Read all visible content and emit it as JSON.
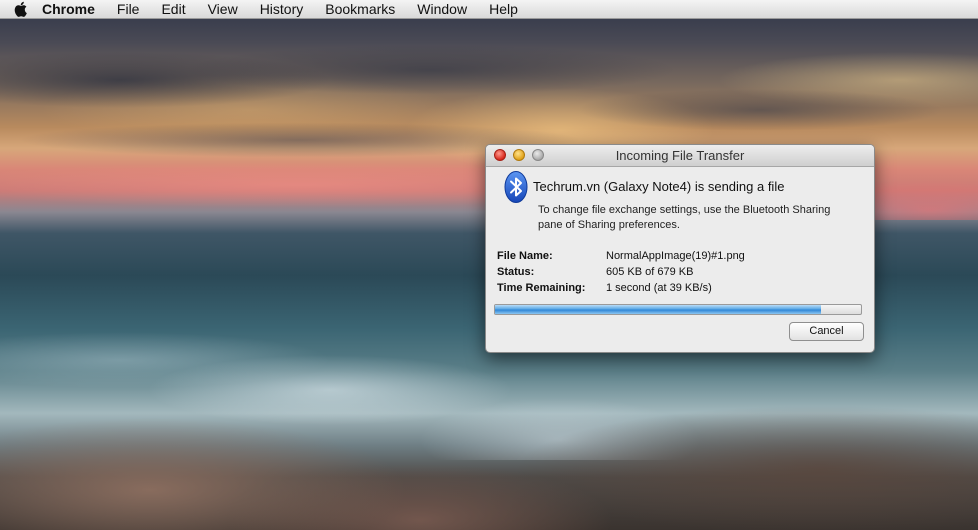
{
  "menubar": {
    "apple_icon": "apple-logo-icon",
    "app_name": "Chrome",
    "items": [
      "File",
      "Edit",
      "View",
      "History",
      "Bookmarks",
      "Window",
      "Help"
    ]
  },
  "dialog": {
    "title": "Incoming File Transfer",
    "icon": "bluetooth-icon",
    "headline": "Techrum.vn (Galaxy Note4) is sending a file",
    "description": "To change file exchange settings, use the Bluetooth Sharing pane of Sharing preferences.",
    "details": [
      {
        "label": "File Name:",
        "value": "NormalAppImage(19)#1.png"
      },
      {
        "label": "Status:",
        "value": "605 KB of 679 KB"
      },
      {
        "label": "Time Remaining:",
        "value": "1 second (at 39 KB/s)"
      }
    ],
    "progress_fraction": 0.89,
    "cancel_label": "Cancel"
  },
  "colors": {
    "progress_blue": "#2f86d6",
    "bluetooth_blue": "#1f5fd6",
    "close_red": "#d8271c",
    "minimize_yellow": "#e0a117"
  }
}
